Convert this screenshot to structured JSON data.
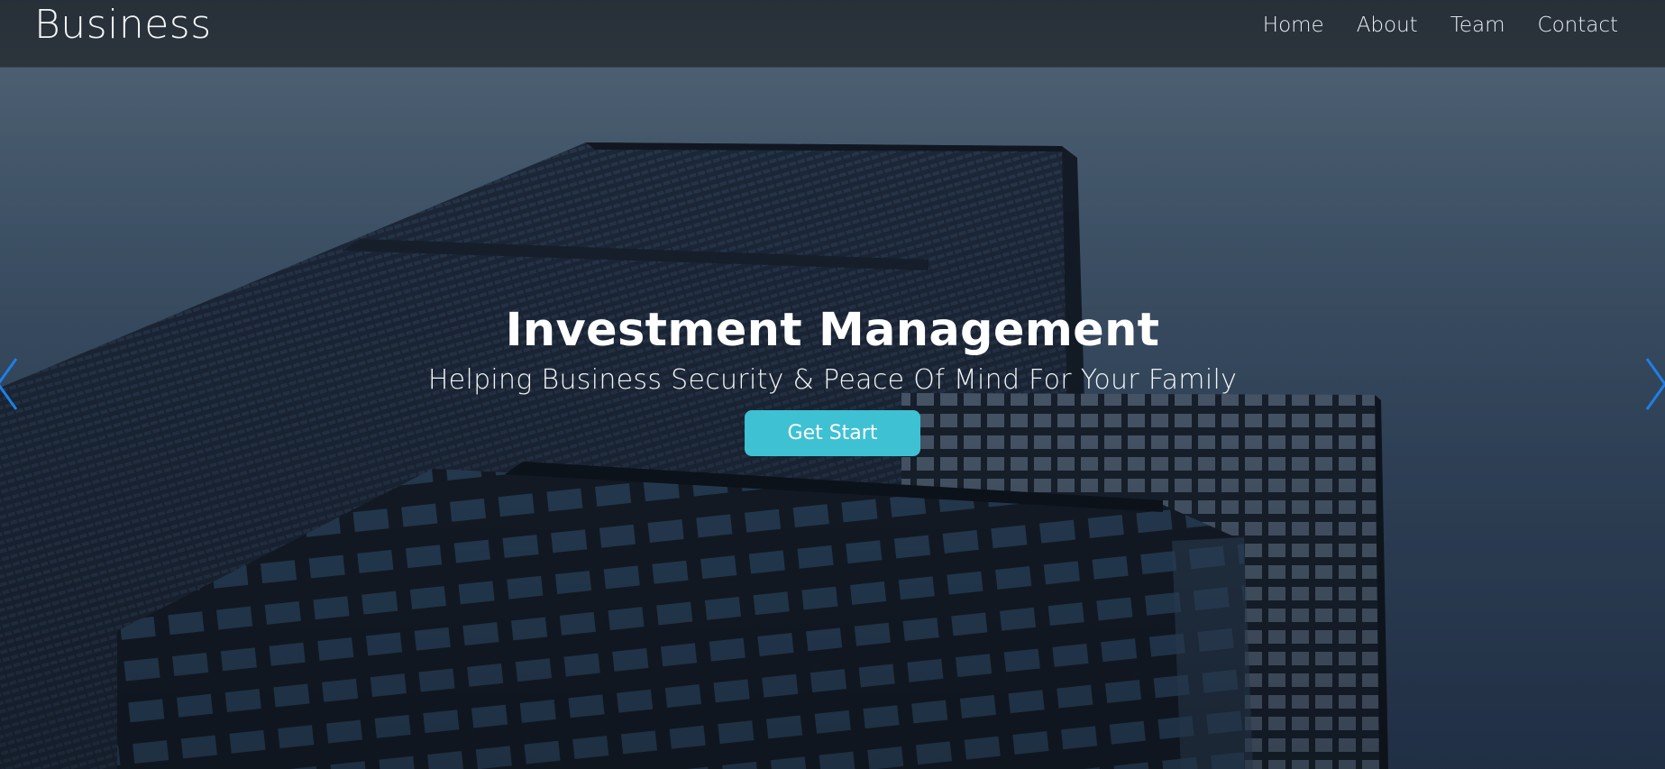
{
  "navbar": {
    "brand": "Business",
    "links": [
      {
        "label": "Home"
      },
      {
        "label": "About"
      },
      {
        "label": "Team"
      },
      {
        "label": "Contact"
      }
    ]
  },
  "carousel": {
    "headline": "Investment Management",
    "subline": "Helping Business Security & Peace Of Mind For Your Family",
    "cta_label": "Get Start",
    "prev_icon": "chevron-left-icon",
    "next_icon": "chevron-right-icon"
  },
  "colors": {
    "navbar_bg": "#2a323b",
    "accent": "#3ec1d3",
    "arrow": "#1e7fe6",
    "text": "#ffffff"
  }
}
